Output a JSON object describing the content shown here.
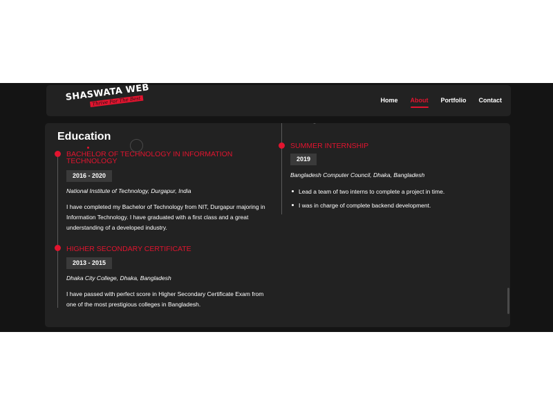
{
  "brand": {
    "logo_text": "SHASWATA WEB",
    "logo_tagline": "Thrive For The Best"
  },
  "nav": {
    "items": [
      {
        "label": "Home"
      },
      {
        "label": "About"
      },
      {
        "label": "Portfolio"
      },
      {
        "label": "Contact"
      }
    ],
    "active": "About"
  },
  "education": {
    "title": "Education",
    "items": [
      {
        "title": "BACHELOR OF TECHNOLOGY IN INFORMATION TECHNOLOGY",
        "years": "2016 - 2020",
        "institution": "National Institute of Technology, Durgapur, India",
        "description": "I have completed my Bachelor of Technology from NIT, Durgapur majoring in Information Technology. I have graduated with a first class and a great understanding of a developed industry."
      },
      {
        "title": "HIGHER SECONDARY CERTIFICATE",
        "years": "2013 - 2015",
        "institution": "Dhaka City College, Dhaka, Bangladesh",
        "description": "I have passed with perfect score in Higher Secondary Certificate Exam from one of the most prestigious colleges in Bangladesh."
      }
    ]
  },
  "experience": {
    "items": [
      {
        "title": "SUMMER INTERNSHIP",
        "years": "2019",
        "organization": "Bangladesh Computer Council, Dhaka, Bangladesh",
        "bullets": [
          "Lead a team of two interns to complete a project in time.",
          "I was in charge of complete backend development."
        ]
      }
    ]
  },
  "colors": {
    "accent": "#e2142f",
    "background": "#141414",
    "panel": "#222222",
    "badge": "#3a3a3a",
    "text": "#ffffff"
  }
}
